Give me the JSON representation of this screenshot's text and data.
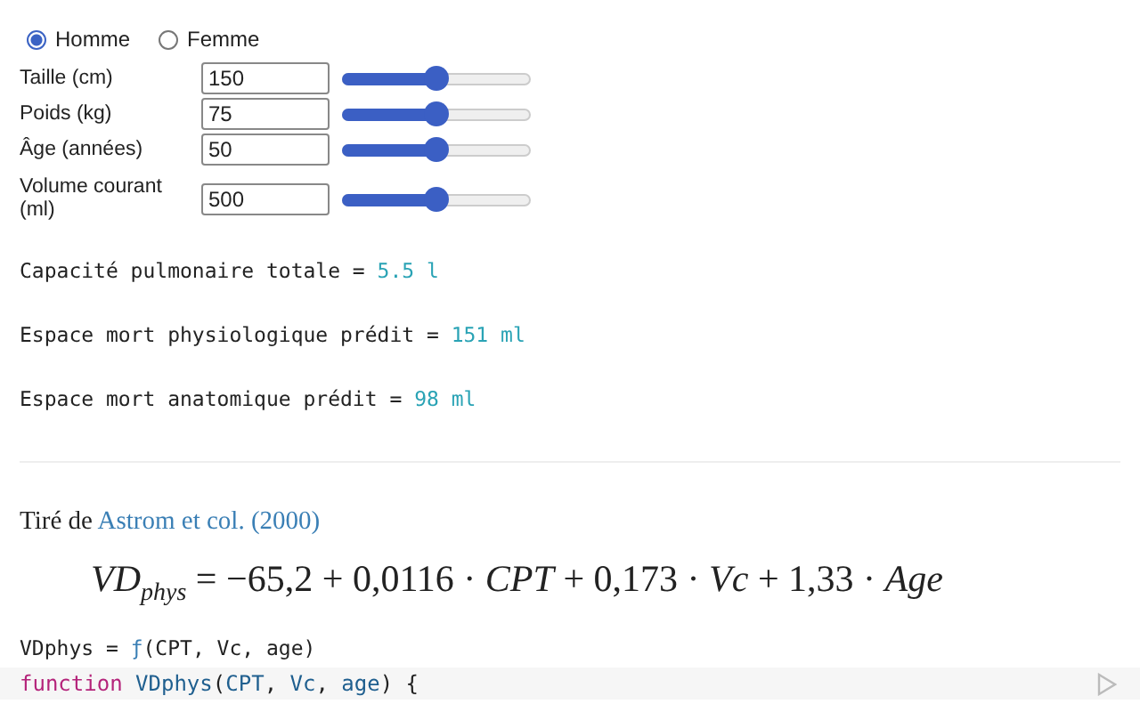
{
  "sex_options": [
    {
      "label": "Homme",
      "selected": true
    },
    {
      "label": "Femme",
      "selected": false
    }
  ],
  "inputs": [
    {
      "label": "Taille (cm)",
      "value": "150",
      "level": 0.5
    },
    {
      "label": "Poids (kg)",
      "value": "75",
      "level": 0.5
    },
    {
      "label": "Âge (années)",
      "value": "50",
      "level": 0.5
    },
    {
      "label": "Volume courant (ml)",
      "value": "500",
      "level": 0.5
    }
  ],
  "results": [
    {
      "label": "Capacité pulmonaire totale =",
      "value": "5.5 l"
    },
    {
      "label": "Espace mort physiologique prédit =",
      "value": "151 ml"
    },
    {
      "label": "Espace mort anatomique prédit =",
      "value": "98 ml"
    }
  ],
  "source": {
    "prefix": "Tiré de",
    "link": "Astrom et col. (2000)"
  },
  "formula": "*VD*$_{phys}$ = −65,2 + 0,0116 · *CPT* + 0,173 · *Vc* + 1,33 · *Age*",
  "cell_output": {
    "name": "VDphys =",
    "symbol": "ƒ",
    "args": "(CPT, Vc, age)"
  },
  "code_tokens": [
    {
      "text": "function ",
      "kind": "keyword"
    },
    {
      "text": "VDphys",
      "kind": "def"
    },
    {
      "text": "(",
      "kind": "plain"
    },
    {
      "text": "CPT",
      "kind": "param"
    },
    {
      "text": ", ",
      "kind": "plain"
    },
    {
      "text": "Vc",
      "kind": "param"
    },
    {
      "text": ", ",
      "kind": "plain"
    },
    {
      "text": "age",
      "kind": "param"
    },
    {
      "text": ") {",
      "kind": "plain"
    }
  ]
}
